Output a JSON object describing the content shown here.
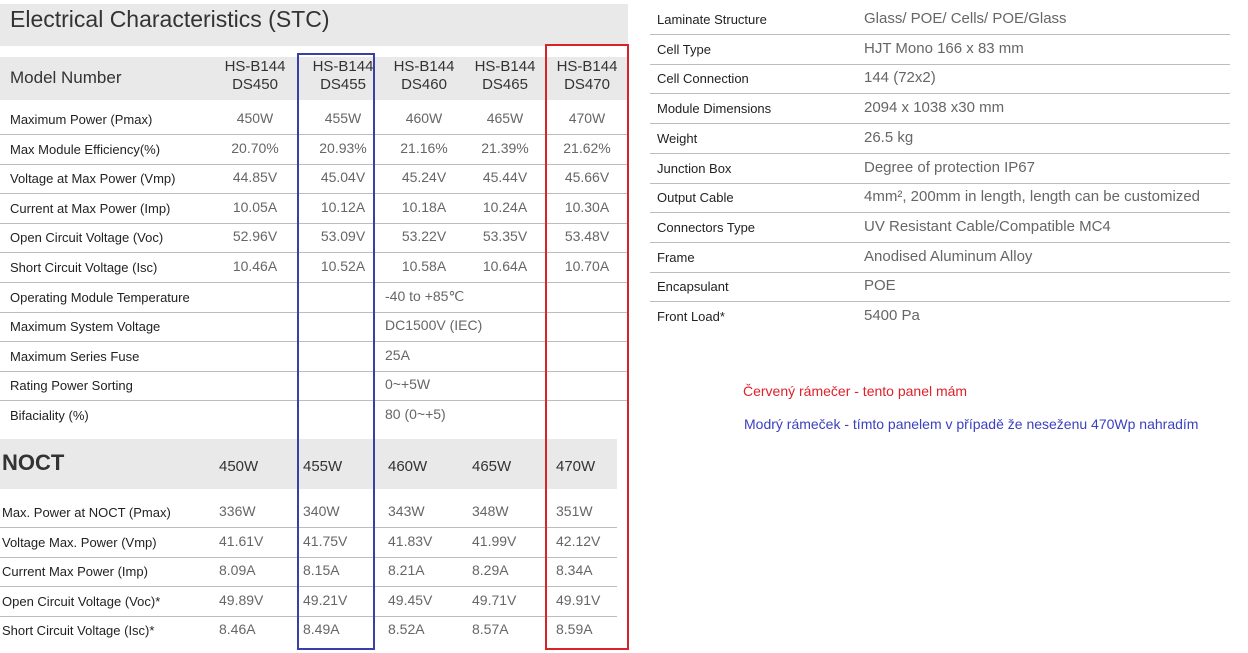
{
  "stc": {
    "title": "Electrical Characteristics (STC)",
    "model_label": "Model Number",
    "models": [
      {
        "line1": "HS-B144",
        "line2": "DS450"
      },
      {
        "line1": "HS-B144",
        "line2": "DS455"
      },
      {
        "line1": "HS-B144",
        "line2": "DS460"
      },
      {
        "line1": "HS-B144",
        "line2": "DS465"
      },
      {
        "line1": "HS-B144",
        "line2": "DS470"
      }
    ],
    "rows": [
      {
        "label": "Maximum Power (Pmax)",
        "values": [
          "450W",
          "455W",
          "460W",
          "465W",
          "470W"
        ]
      },
      {
        "label": "Max Module Efficiency(%)",
        "values": [
          "20.70%",
          "20.93%",
          "21.16%",
          "21.39%",
          "21.62%"
        ]
      },
      {
        "label": "Voltage at Max Power (Vmp)",
        "values": [
          "44.85V",
          "45.04V",
          "45.24V",
          "45.44V",
          "45.66V"
        ]
      },
      {
        "label": "Current at Max Power (Imp)",
        "values": [
          "10.05A",
          "10.12A",
          "10.18A",
          "10.24A",
          "10.30A"
        ]
      },
      {
        "label": "Open Circuit Voltage (Voc)",
        "values": [
          "52.96V",
          "53.09V",
          "53.22V",
          "53.35V",
          "53.48V"
        ]
      },
      {
        "label": "Short Circuit Voltage (Isc)",
        "values": [
          "10.46A",
          "10.52A",
          "10.58A",
          "10.64A",
          "10.70A"
        ]
      }
    ],
    "common_rows": [
      {
        "label": "Operating Module Temperature",
        "value": "-40 to +85℃"
      },
      {
        "label": "Maximum System Voltage",
        "value": "DC1500V (IEC)"
      },
      {
        "label": "Maximum Series Fuse",
        "value": "25A"
      },
      {
        "label": "Rating Power Sorting",
        "value": "0~+5W"
      },
      {
        "label": "Bifaciality (%)",
        "value": "80 (0~+5)"
      }
    ]
  },
  "noct": {
    "title": "NOCT",
    "headers": [
      "450W",
      "455W",
      "460W",
      "465W",
      "470W"
    ],
    "rows": [
      {
        "label": "Max. Power at NOCT (Pmax)",
        "values": [
          "336W",
          "340W",
          "343W",
          "348W",
          "351W"
        ]
      },
      {
        "label": "Voltage Max. Power (Vmp)",
        "values": [
          "41.61V",
          "41.75V",
          "41.83V",
          "41.99V",
          "42.12V"
        ]
      },
      {
        "label": "Current Max Power (Imp)",
        "values": [
          "8.09A",
          "8.15A",
          "8.21A",
          "8.29A",
          "8.34A"
        ]
      },
      {
        "label": "Open Circuit Voltage (Voc)*",
        "values": [
          "49.89V",
          "49.21V",
          "49.45V",
          "49.71V",
          "49.91V"
        ]
      },
      {
        "label": "Short Circuit Voltage (Isc)*",
        "values": [
          "8.46A",
          "8.49A",
          "8.52A",
          "8.57A",
          "8.59A"
        ]
      }
    ]
  },
  "mechanical": [
    {
      "label": "Laminate Structure",
      "value": "Glass/ POE/ Cells/ POE/Glass"
    },
    {
      "label": "Cell Type",
      "value": "HJT Mono 166 x 83 mm"
    },
    {
      "label": "Cell Connection",
      "value": "144 (72x2)"
    },
    {
      "label": "Module Dimensions",
      "value": "2094 x 1038 x30 mm"
    },
    {
      "label": "Weight",
      "value": "26.5 kg"
    },
    {
      "label": "Junction Box",
      "value": "Degree of protection IP67"
    },
    {
      "label": "Output Cable",
      "value": "4mm², 200mm in length, length can be customized"
    },
    {
      "label": "Connectors Type",
      "value": "UV Resistant Cable/Compatible MC4"
    },
    {
      "label": "Frame",
      "value": "Anodised Aluminum Alloy"
    },
    {
      "label": "Encapsulant",
      "value": "POE"
    },
    {
      "label": "Front Load*",
      "value": "5400 Pa"
    }
  ],
  "notes": {
    "red": "Červený rámečer - tento panel mám",
    "blue": "Modrý rámeček - tímto panelem v případě že neseženu 470Wp nahradím"
  },
  "colors": {
    "red_box": "#d8232a",
    "blue_box": "#3a3fa8",
    "red_text": "#e0202a",
    "blue_text": "#3b40c0"
  }
}
